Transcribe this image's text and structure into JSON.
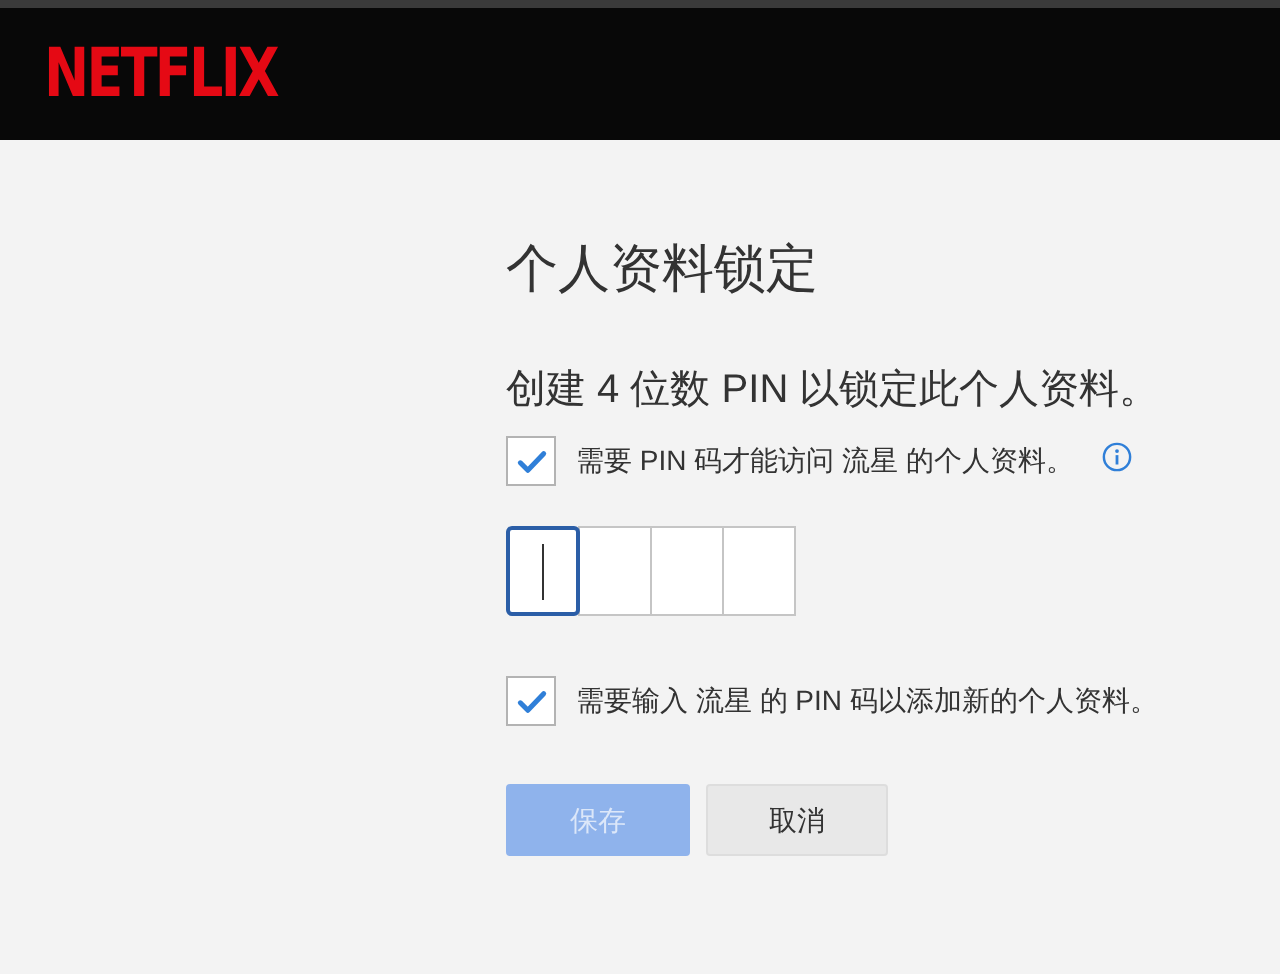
{
  "header": {
    "logo": "NETFLIX"
  },
  "title": "个人资料锁定",
  "subtitle": "创建 4 位数 PIN 以锁定此个人资料。",
  "options": [
    {
      "label": "需要 PIN 码才能访问 流星 的个人资料。",
      "checked": true,
      "info": true
    },
    {
      "label": "需要输入 流星 的 PIN 码以添加新的个人资料。",
      "checked": true,
      "info": false
    }
  ],
  "pin_boxes": [
    {
      "selected": true
    },
    {
      "selected": false
    },
    {
      "selected": false
    },
    {
      "selected": false
    }
  ],
  "buttons": [
    {
      "label": "保存",
      "kind": "primary",
      "disabled": true
    },
    {
      "label": "取消",
      "kind": "secondary",
      "disabled": false
    }
  ]
}
